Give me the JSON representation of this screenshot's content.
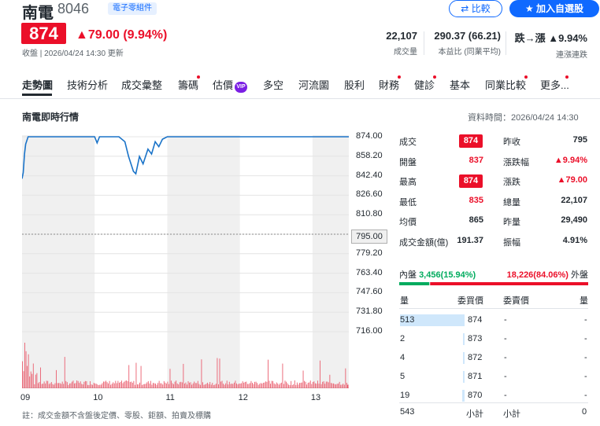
{
  "header": {
    "name": "南電",
    "code": "8046",
    "tag": "電子零組件",
    "compare_label": "比較",
    "watchlist_label": "加入自選股",
    "price": "874",
    "change": "▲79.00 (9.94%)",
    "close_time": "收盤 | 2026/04/24 14:30 更新",
    "stats": [
      {
        "value": "22,107",
        "label": "成交量"
      },
      {
        "value": "290.37 (66.21)",
        "label": "本益比 (同業平均)"
      },
      {
        "value": "跌→漲 ▲9.94%",
        "label": "連漲連跌"
      }
    ]
  },
  "tabs": [
    {
      "label": "走勢圖",
      "active": true,
      "dot": false
    },
    {
      "label": "技術分析",
      "dot": false
    },
    {
      "label": "成交彙整",
      "dot": false
    },
    {
      "label": "籌碼",
      "dot": true
    },
    {
      "label": "估價",
      "dot": false,
      "badge": "VIP"
    },
    {
      "label": "多空",
      "dot": false
    },
    {
      "label": "河流圖",
      "dot": false
    },
    {
      "label": "股利",
      "dot": false
    },
    {
      "label": "財務",
      "dot": true
    },
    {
      "label": "健診",
      "dot": true
    },
    {
      "label": "基本",
      "dot": false
    },
    {
      "label": "同業比較",
      "dot": true
    },
    {
      "label": "更多",
      "dot": true
    }
  ],
  "section": {
    "title": "南電即時行情",
    "data_time": "資料時間：2026/04/24 14:30"
  },
  "chart_data": {
    "type": "line",
    "x_ticks": [
      "09",
      "10",
      "11",
      "12",
      "13"
    ],
    "y_ticks": [
      "874.00",
      "858.20",
      "842.40",
      "826.60",
      "810.80",
      "795.00",
      "779.20",
      "763.40",
      "747.60",
      "731.80",
      "716.00"
    ],
    "ylim": [
      716.0,
      874.0
    ],
    "reference_price": "795.00",
    "price_series": [
      [
        "09:00",
        840
      ],
      [
        "09:01",
        845
      ],
      [
        "09:02",
        860
      ],
      [
        "09:03",
        868
      ],
      [
        "09:05",
        874
      ],
      [
        "09:30",
        874
      ],
      [
        "10:00",
        874
      ],
      [
        "10:02",
        869
      ],
      [
        "10:04",
        874
      ],
      [
        "10:20",
        874
      ],
      [
        "10:25",
        870
      ],
      [
        "10:28",
        858
      ],
      [
        "10:32",
        846
      ],
      [
        "10:34",
        844
      ],
      [
        "10:37",
        858
      ],
      [
        "10:40",
        852
      ],
      [
        "10:44",
        864
      ],
      [
        "10:47",
        860
      ],
      [
        "10:50",
        870
      ],
      [
        "10:53",
        866
      ],
      [
        "10:56",
        872
      ],
      [
        "11:00",
        874
      ],
      [
        "12:00",
        874
      ],
      [
        "13:00",
        874
      ],
      [
        "13:30",
        874
      ]
    ],
    "grid": true,
    "shaded_bands": [
      [
        "09:00",
        "10:00"
      ],
      [
        "11:00",
        "12:00"
      ],
      [
        "13:00",
        "13:30"
      ]
    ],
    "line_color": "#1a73c8",
    "volume_color": "#ea5f6f"
  },
  "quote": {
    "left": [
      {
        "label": "成交",
        "value": "874",
        "boxed": true
      },
      {
        "label": "開盤",
        "value": "837",
        "color": "red"
      },
      {
        "label": "最高",
        "value": "874",
        "boxed": true
      },
      {
        "label": "最低",
        "value": "835",
        "color": "red"
      },
      {
        "label": "均價",
        "value": "865",
        "color": "dark"
      },
      {
        "label": "成交金額(億)",
        "value": "191.37",
        "color": "dark"
      }
    ],
    "right": [
      {
        "label": "昨收",
        "value": "795",
        "color": "dark"
      },
      {
        "label": "漲跌幅",
        "value": "▲9.94%",
        "color": "red"
      },
      {
        "label": "漲跌",
        "value": "▲79.00",
        "color": "red"
      },
      {
        "label": "總量",
        "value": "22,107",
        "color": "dark"
      },
      {
        "label": "昨量",
        "value": "29,490",
        "color": "dark"
      },
      {
        "label": "振幅",
        "value": "4.91%",
        "color": "dark"
      }
    ]
  },
  "inout": {
    "inner_label": "內盤",
    "inner_value": "3,456(15.94%)",
    "outer_value": "18,226(84.06%)",
    "outer_label": "外盤",
    "inner_fraction": 0.1594
  },
  "orderbook": {
    "headers": [
      "量",
      "委買價",
      "委賣價",
      "量"
    ],
    "rows": [
      {
        "bid_vol": "513",
        "bid": "874",
        "ask": "-",
        "ask_vol": "-"
      },
      {
        "bid_vol": "2",
        "bid": "873",
        "ask": "-",
        "ask_vol": "-"
      },
      {
        "bid_vol": "4",
        "bid": "872",
        "ask": "-",
        "ask_vol": "-"
      },
      {
        "bid_vol": "5",
        "bid": "871",
        "ask": "-",
        "ask_vol": "-"
      },
      {
        "bid_vol": "19",
        "bid": "870",
        "ask": "-",
        "ask_vol": "-"
      }
    ],
    "subtotal_bid_vol": "543",
    "subtotal_label": "小計",
    "subtotal_label_ask": "小計",
    "subtotal_ask_vol": "0"
  },
  "footnote": "註：成交金額不含盤後定價、零股、鉅額、拍賣及標購"
}
